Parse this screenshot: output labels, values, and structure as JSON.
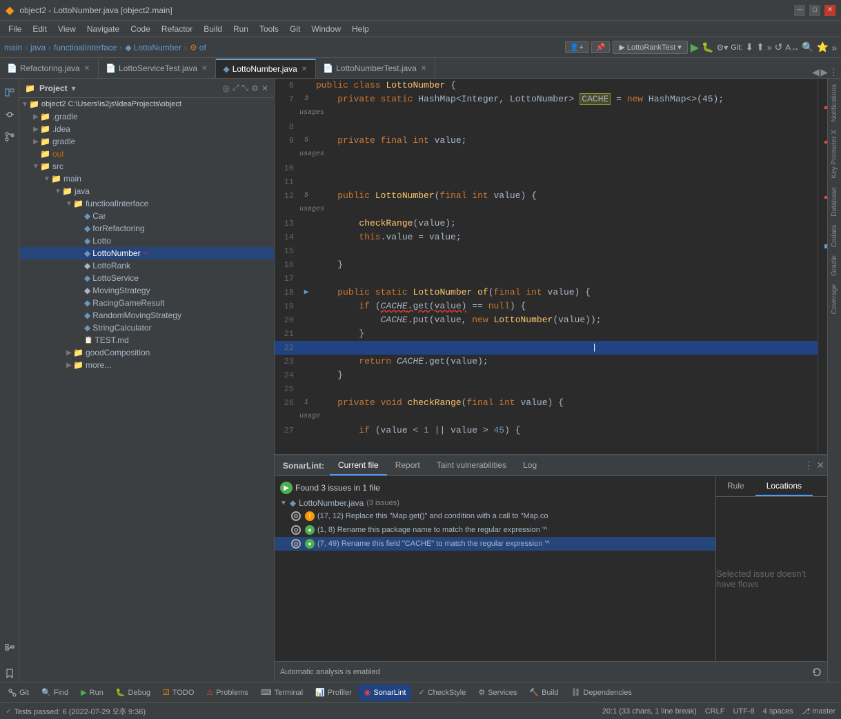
{
  "titlebar": {
    "title": "object2 - LottoNumber.java [object2.main]",
    "controls": [
      "minimize",
      "maximize",
      "close"
    ]
  },
  "menubar": {
    "items": [
      "File",
      "Edit",
      "View",
      "Navigate",
      "Code",
      "Refactor",
      "Build",
      "Run",
      "Tools",
      "Git",
      "Window",
      "Help"
    ]
  },
  "navbar": {
    "breadcrumb": [
      "main",
      "java",
      "functioalInterface",
      "LottoNumber",
      "of"
    ],
    "runconfig": "LottoRankTest",
    "git_label": "Git:"
  },
  "tabs": [
    {
      "label": "Refactoring.java",
      "active": false
    },
    {
      "label": "LottoServiceTest.java",
      "active": false
    },
    {
      "label": "LottoNumber.java",
      "active": true
    },
    {
      "label": "LottoNumberTest.java",
      "active": false
    }
  ],
  "sidebar": {
    "title": "Project",
    "tree": [
      {
        "level": 0,
        "arrow": "▼",
        "icon": "📁",
        "label": "object2 C:\\Users\\is2js\\IdeaProjects\\objec",
        "type": "folder",
        "selected": false
      },
      {
        "level": 1,
        "arrow": "▶",
        "icon": "📁",
        "label": ".gradle",
        "type": "folder",
        "selected": false
      },
      {
        "level": 1,
        "arrow": "▶",
        "icon": "📁",
        "label": ".idea",
        "type": "folder",
        "selected": false
      },
      {
        "level": 1,
        "arrow": "▶",
        "icon": "📁",
        "label": "gradle",
        "type": "folder",
        "selected": false
      },
      {
        "level": 1,
        "arrow": "",
        "icon": "📁",
        "label": "out",
        "type": "folder",
        "selected": false
      },
      {
        "level": 1,
        "arrow": "▼",
        "icon": "📁",
        "label": "src",
        "type": "folder",
        "selected": false
      },
      {
        "level": 2,
        "arrow": "▼",
        "icon": "📁",
        "label": "main",
        "type": "folder",
        "selected": false
      },
      {
        "level": 3,
        "arrow": "▼",
        "icon": "📁",
        "label": "java",
        "type": "folder",
        "selected": false
      },
      {
        "level": 4,
        "arrow": "▼",
        "icon": "📁",
        "label": "functioalInterface",
        "type": "folder",
        "selected": false
      },
      {
        "level": 5,
        "arrow": "▶",
        "icon": "🔷",
        "label": "Car",
        "type": "java",
        "selected": false
      },
      {
        "level": 5,
        "arrow": "▶",
        "icon": "🔷",
        "label": "forRefactoring",
        "type": "java",
        "selected": false
      },
      {
        "level": 5,
        "arrow": "",
        "icon": "🔷",
        "label": "Lotto",
        "type": "java",
        "selected": false
      },
      {
        "level": 5,
        "arrow": "",
        "icon": "🔷",
        "label": "LottoNumber",
        "type": "java",
        "selected": true
      },
      {
        "level": 5,
        "arrow": "",
        "icon": "🔷",
        "label": "LottoRank",
        "type": "java",
        "selected": false
      },
      {
        "level": 5,
        "arrow": "",
        "icon": "🔷",
        "label": "LottoService",
        "type": "java",
        "selected": false
      },
      {
        "level": 5,
        "arrow": "",
        "icon": "🔷",
        "label": "MovingStrategy",
        "type": "java",
        "selected": false
      },
      {
        "level": 5,
        "arrow": "",
        "icon": "🔷",
        "label": "RacingGameResult",
        "type": "java",
        "selected": false
      },
      {
        "level": 5,
        "arrow": "",
        "icon": "🔷",
        "label": "RandomMovingStrategy",
        "type": "java",
        "selected": false
      },
      {
        "level": 5,
        "arrow": "",
        "icon": "🔷",
        "label": "StringCalculator",
        "type": "java",
        "selected": false
      },
      {
        "level": 5,
        "arrow": "",
        "icon": "📄",
        "label": "TEST.md",
        "type": "md",
        "selected": false
      },
      {
        "level": 4,
        "arrow": "▶",
        "icon": "📁",
        "label": "goodComposition",
        "type": "folder",
        "selected": false
      },
      {
        "level": 4,
        "arrow": "▶",
        "icon": "📁",
        "label": "more...",
        "type": "folder",
        "selected": false
      }
    ]
  },
  "editor": {
    "lines": [
      {
        "num": 6,
        "gutter": "",
        "code": "public class LottoNumber {",
        "highlight": false
      },
      {
        "num": 7,
        "gutter": "3 usages",
        "code": "    private static HashMap<Integer, LottoNumber> CACHE = new HashMap<>(45);",
        "highlight": false
      },
      {
        "num": 8,
        "gutter": "",
        "code": "",
        "highlight": false
      },
      {
        "num": 9,
        "gutter": "5 usages",
        "code": "    private final int value;",
        "highlight": false
      },
      {
        "num": 10,
        "gutter": "",
        "code": "",
        "highlight": false
      },
      {
        "num": 11,
        "gutter": "",
        "code": "",
        "highlight": false
      },
      {
        "num": 12,
        "gutter": "5 usages",
        "code": "    public LottoNumber(final int value) {",
        "highlight": false
      },
      {
        "num": 13,
        "gutter": "",
        "code": "        checkRange(value);",
        "highlight": false
      },
      {
        "num": 14,
        "gutter": "",
        "code": "        this.value = value;",
        "highlight": false
      },
      {
        "num": 15,
        "gutter": "",
        "code": "",
        "highlight": false
      },
      {
        "num": 16,
        "gutter": "",
        "code": "    }",
        "highlight": false
      },
      {
        "num": 17,
        "gutter": "",
        "code": "",
        "highlight": false
      },
      {
        "num": 18,
        "gutter": "",
        "code": "    public static LottoNumber of(final int value) {",
        "highlight": false
      },
      {
        "num": 19,
        "gutter": "",
        "code": "        if (CACHE.get(value) == null) {",
        "highlight": false
      },
      {
        "num": 20,
        "gutter": "",
        "code": "            CACHE.put(value, new LottoNumber(value));",
        "highlight": false
      },
      {
        "num": 21,
        "gutter": "",
        "code": "        }",
        "highlight": false
      },
      {
        "num": 22,
        "gutter": "",
        "code": "",
        "highlight": true
      },
      {
        "num": 23,
        "gutter": "",
        "code": "        return CACHE.get(value);",
        "highlight": false
      },
      {
        "num": 24,
        "gutter": "",
        "code": "    }",
        "highlight": false
      },
      {
        "num": 25,
        "gutter": "",
        "code": "",
        "highlight": false
      },
      {
        "num": 26,
        "gutter": "1 usage",
        "code": "    private void checkRange(final int value) {",
        "highlight": false
      },
      {
        "num": 27,
        "gutter": "",
        "code": "        if (value < 1 || value > 45) {",
        "highlight": false
      }
    ]
  },
  "sonarlint": {
    "tabs": [
      "SonarLint:",
      "Current file",
      "Report",
      "Taint vulnerabilities",
      "Log"
    ],
    "issues_header": "Found 3 issues in 1 file",
    "file_label": "LottoNumber.java (3 issues)",
    "issues": [
      {
        "badges": [
          "error",
          "warn"
        ],
        "text": "(17, 12) Replace this \"Map.get()\" and condition with a call to \"Map.co",
        "selected": false
      },
      {
        "badges": [
          "info",
          "green"
        ],
        "text": "(1, 8) Rename this package name to match the regular expression '^",
        "selected": false
      },
      {
        "badges": [
          "info",
          "green"
        ],
        "text": "(7, 49) Rename this field \"CACHE\" to match the regular expression '^",
        "selected": true
      }
    ],
    "locations_tabs": [
      "Rule",
      "Locations"
    ],
    "locations_message": "Selected issue doesn't have flows"
  },
  "status_bar": {
    "tests": "Tests passed: 6 (2022-07-29 오후 9:36)",
    "position": "20:1 (33 chars, 1 line break)",
    "encoding": "CRLF",
    "charset": "UTF-8",
    "indent": "4 spaces",
    "git_branch": "master"
  },
  "bottom_tools": {
    "items": [
      {
        "label": "Git",
        "icon": "git",
        "active": false
      },
      {
        "label": "Find",
        "icon": "find",
        "active": false
      },
      {
        "label": "Run",
        "icon": "run",
        "active": false,
        "color": "green"
      },
      {
        "label": "Debug",
        "icon": "debug",
        "active": false,
        "color": "red"
      },
      {
        "label": "TODO",
        "icon": "todo",
        "active": false,
        "color": "orange"
      },
      {
        "label": "Problems",
        "icon": "problems",
        "active": false,
        "color": "red"
      },
      {
        "label": "Terminal",
        "icon": "terminal",
        "active": false
      },
      {
        "label": "Profiler",
        "icon": "profiler",
        "active": false
      },
      {
        "label": "SonarLint",
        "icon": "sonar",
        "active": true,
        "color": "red"
      },
      {
        "label": "CheckStyle",
        "icon": "check",
        "active": false
      },
      {
        "label": "Services",
        "icon": "services",
        "active": false
      },
      {
        "label": "Build",
        "icon": "build",
        "active": false
      },
      {
        "label": "Dependencies",
        "icon": "deps",
        "active": false
      }
    ]
  },
  "far_right_panels": [
    "Notifications",
    "Key Promoter X",
    "Database",
    "Codata",
    "Gradle",
    "Coverage"
  ]
}
